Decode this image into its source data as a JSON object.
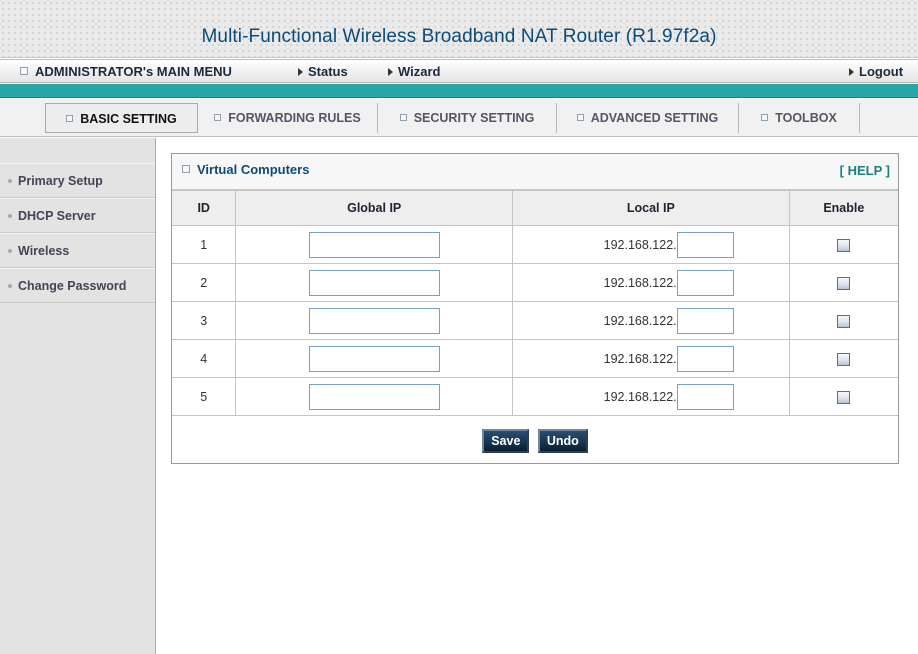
{
  "header": {
    "title": "Multi-Functional Wireless Broadband NAT Router (R1.97f2a)"
  },
  "menubar": {
    "main_menu": "ADMINISTRATOR's MAIN MENU",
    "status": "Status",
    "wizard": "Wizard",
    "logout": "Logout"
  },
  "tabs": [
    {
      "label": "BASIC SETTING",
      "active": true
    },
    {
      "label": "FORWARDING RULES",
      "active": false
    },
    {
      "label": "SECURITY SETTING",
      "active": false
    },
    {
      "label": "ADVANCED SETTING",
      "active": false
    },
    {
      "label": "TOOLBOX",
      "active": false
    }
  ],
  "sidebar": {
    "items": [
      {
        "label": "Primary Setup"
      },
      {
        "label": "DHCP Server"
      },
      {
        "label": "Wireless"
      },
      {
        "label": "Change Password"
      }
    ]
  },
  "panel": {
    "title": "Virtual Computers",
    "help": "[ HELP ]",
    "columns": [
      "ID",
      "Global IP",
      "Local IP",
      "Enable"
    ],
    "rows": [
      {
        "id": "1",
        "global_ip": "",
        "local_prefix": "192.168.122.",
        "local_suffix": "",
        "enabled": false
      },
      {
        "id": "2",
        "global_ip": "",
        "local_prefix": "192.168.122.",
        "local_suffix": "",
        "enabled": false
      },
      {
        "id": "3",
        "global_ip": "",
        "local_prefix": "192.168.122.",
        "local_suffix": "",
        "enabled": false
      },
      {
        "id": "4",
        "global_ip": "",
        "local_prefix": "192.168.122.",
        "local_suffix": "",
        "enabled": false
      },
      {
        "id": "5",
        "global_ip": "",
        "local_prefix": "192.168.122.",
        "local_suffix": "",
        "enabled": false
      }
    ],
    "save_label": "Save",
    "undo_label": "Undo"
  },
  "colors": {
    "title": "#0b4b78",
    "accent_bar": "#27a6a6",
    "help": "#1c7e7e",
    "button": "#0a1f33"
  }
}
